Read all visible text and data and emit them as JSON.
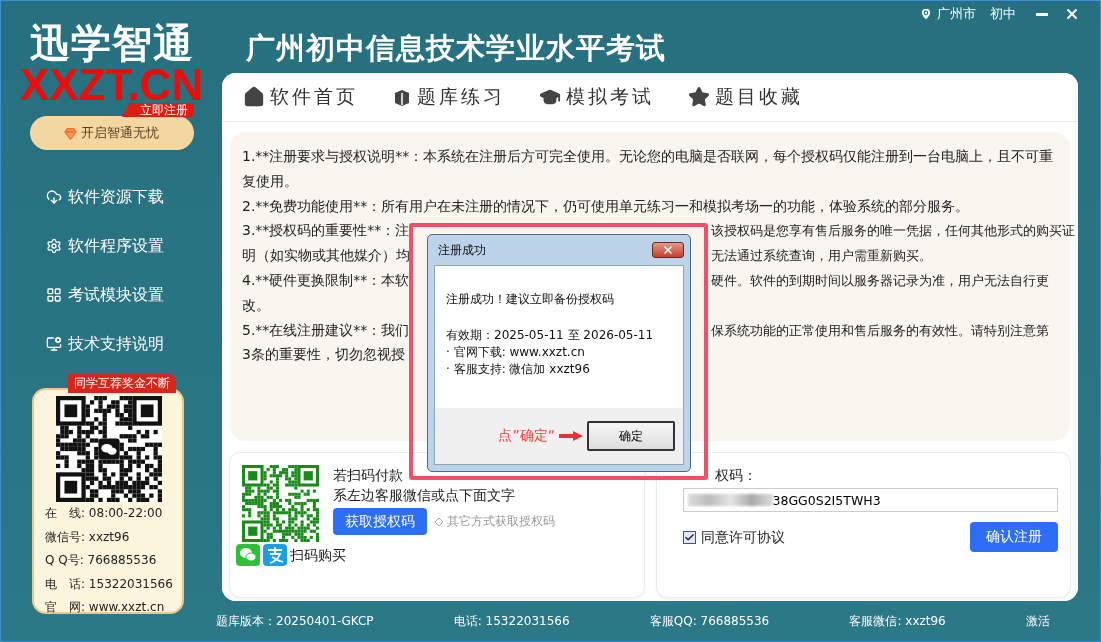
{
  "location": {
    "city": "广州市",
    "level": "初中"
  },
  "logo": {
    "title": "迅学智通",
    "domain": "XXZT.CN",
    "tag": "立即注册"
  },
  "promo_button": "开启智通无忧",
  "sidebar": {
    "items": [
      {
        "label": "软件资源下载"
      },
      {
        "label": "软件程序设置"
      },
      {
        "label": "考试模块设置"
      },
      {
        "label": "技术支持说明"
      }
    ]
  },
  "contact_card": {
    "ribbon": "同学互荐奖金不断",
    "rows": [
      "在　线: 08:00-22:00",
      "微信号: xxzt96",
      "Q Q号: 766885536",
      "电　话: 15322031566",
      "官　网: www.xxzt.cn"
    ]
  },
  "title": "广州初中信息技术学业水平考试",
  "tabs": [
    {
      "label": "软件首页"
    },
    {
      "label": "题库练习"
    },
    {
      "label": "模拟考试"
    },
    {
      "label": "题目收藏"
    }
  ],
  "notice": {
    "lines": [
      {
        "text": "1.**注册要求与授权说明**：本系统在注册后方可完全使用。无论您的电脑是否联网，每个授权码仅能注册到一台电脑上，且不可重"
      },
      {
        "text": "复使用。"
      },
      {
        "text": "2.**免费功能使用**：所有用户在未注册的情况下，仍可使用单元练习一和模拟考场一的功能，体验系统的部分服务。"
      },
      {
        "left": "3.**授权码的重要性**：注",
        "right": "该授权码是您享有售后服务的唯一凭据，任何其他形式的购买证"
      },
      {
        "left": "明（如实物或其他媒介）均",
        "right": "无法通过系统查询，用户需重新购买。"
      },
      {
        "left": "4.**硬件更换限制**：本软",
        "right": "硬件。软件的到期时间以服务器记录为准，用户无法自行更"
      },
      {
        "text": "改。"
      },
      {
        "left": "5.**在线注册建议**：我们",
        "right": "保系统功能的正常使用和售后服务的有效性。请特别注意第"
      },
      {
        "left": "3条的重要性，切勿忽视授"
      }
    ]
  },
  "purchase": {
    "lines": [
      "若扫码付款",
      "系左边客服微信或点下面文字"
    ],
    "button": "获取授权码",
    "alt_link": "其它方式获取授权码",
    "pay_label": "扫码购买"
  },
  "register": {
    "label": "权码：",
    "code": "38GG0S2I5TWH3",
    "agree": {
      "label": "同意许可协议",
      "checked": true
    },
    "button": "确认注册"
  },
  "status_bar": [
    "题库版本：20250401-GKCP",
    "电话: 15322031566",
    "客服QQ: 766885536",
    "客服微信: xxzt96",
    "激活"
  ],
  "dialog": {
    "title": "注册成功",
    "message": "注册成功！建议立即备份授权码",
    "validity": "有效期：2025-05-11 至 2026-05-11",
    "bullets": [
      "· 官网下载: www.xxzt.cn",
      "· 客服支持: 微信加 xxzt96"
    ],
    "hint": "点”确定“",
    "ok": "确定"
  }
}
